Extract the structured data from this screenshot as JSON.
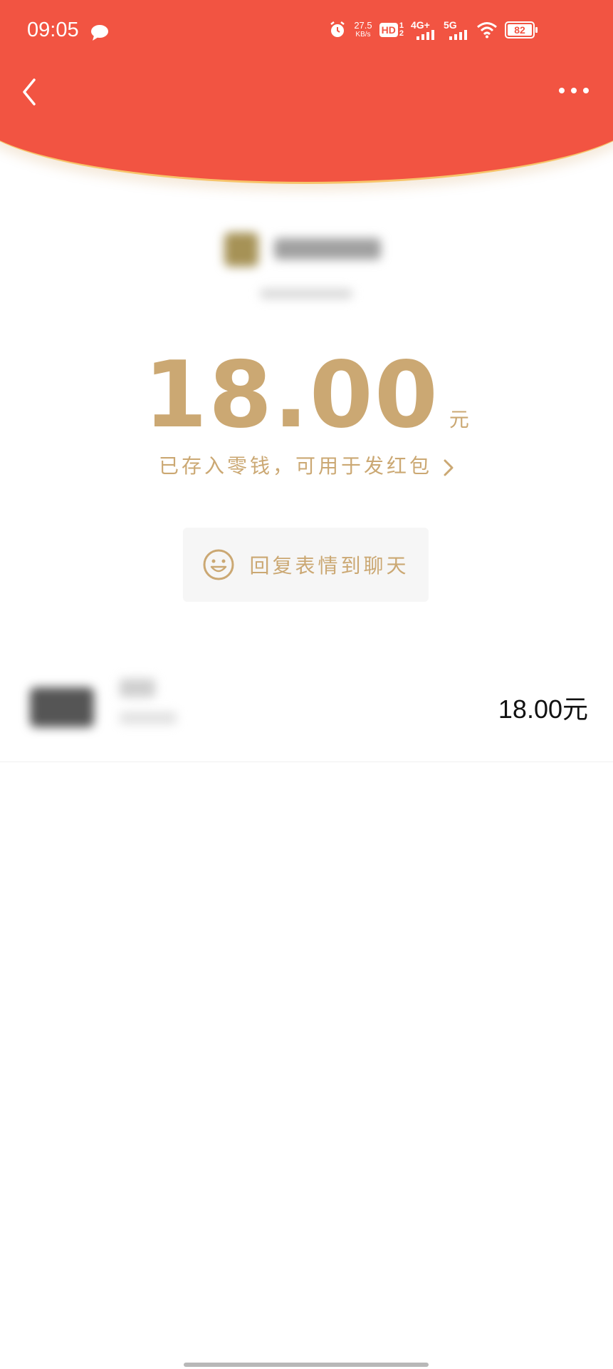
{
  "status_bar": {
    "time": "09:05",
    "net_speed_value": "27.5",
    "net_speed_unit": "KB/s",
    "hd": "HD",
    "hd_sub_top": "1",
    "hd_sub_bottom": "2",
    "network_1": "4G+",
    "network_2": "5G",
    "battery": "82"
  },
  "header": {
    "color": "#f25442"
  },
  "packet": {
    "amount": "18.00",
    "unit": "元",
    "deposit_note": "已存入零钱，可用于发红包"
  },
  "reply_button": {
    "label": "回复表情到聊天"
  },
  "receivers": [
    {
      "amount": "18.00元"
    }
  ],
  "colors": {
    "accent_gold": "#cba873",
    "header_red": "#f25442"
  }
}
